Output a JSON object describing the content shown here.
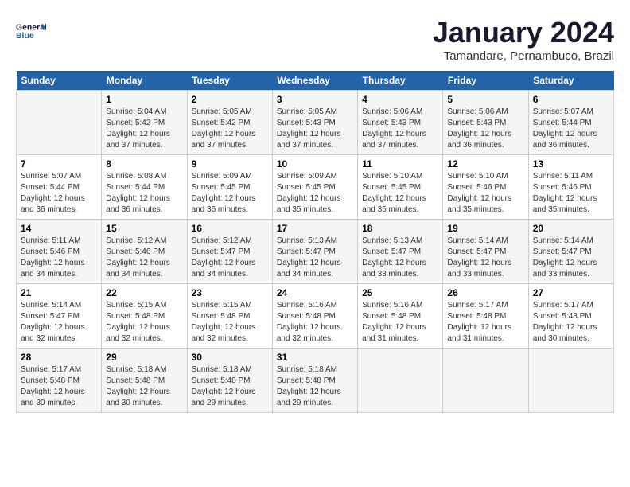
{
  "logo": {
    "line1": "General",
    "line2": "Blue"
  },
  "title": "January 2024",
  "subtitle": "Tamandare, Pernambuco, Brazil",
  "days_header": [
    "Sunday",
    "Monday",
    "Tuesday",
    "Wednesday",
    "Thursday",
    "Friday",
    "Saturday"
  ],
  "weeks": [
    [
      {
        "day": "",
        "sunrise": "",
        "sunset": "",
        "daylight": ""
      },
      {
        "day": "1",
        "sunrise": "Sunrise: 5:04 AM",
        "sunset": "Sunset: 5:42 PM",
        "daylight": "Daylight: 12 hours and 37 minutes."
      },
      {
        "day": "2",
        "sunrise": "Sunrise: 5:05 AM",
        "sunset": "Sunset: 5:42 PM",
        "daylight": "Daylight: 12 hours and 37 minutes."
      },
      {
        "day": "3",
        "sunrise": "Sunrise: 5:05 AM",
        "sunset": "Sunset: 5:43 PM",
        "daylight": "Daylight: 12 hours and 37 minutes."
      },
      {
        "day": "4",
        "sunrise": "Sunrise: 5:06 AM",
        "sunset": "Sunset: 5:43 PM",
        "daylight": "Daylight: 12 hours and 37 minutes."
      },
      {
        "day": "5",
        "sunrise": "Sunrise: 5:06 AM",
        "sunset": "Sunset: 5:43 PM",
        "daylight": "Daylight: 12 hours and 36 minutes."
      },
      {
        "day": "6",
        "sunrise": "Sunrise: 5:07 AM",
        "sunset": "Sunset: 5:44 PM",
        "daylight": "Daylight: 12 hours and 36 minutes."
      }
    ],
    [
      {
        "day": "7",
        "sunrise": "Sunrise: 5:07 AM",
        "sunset": "Sunset: 5:44 PM",
        "daylight": "Daylight: 12 hours and 36 minutes."
      },
      {
        "day": "8",
        "sunrise": "Sunrise: 5:08 AM",
        "sunset": "Sunset: 5:44 PM",
        "daylight": "Daylight: 12 hours and 36 minutes."
      },
      {
        "day": "9",
        "sunrise": "Sunrise: 5:09 AM",
        "sunset": "Sunset: 5:45 PM",
        "daylight": "Daylight: 12 hours and 36 minutes."
      },
      {
        "day": "10",
        "sunrise": "Sunrise: 5:09 AM",
        "sunset": "Sunset: 5:45 PM",
        "daylight": "Daylight: 12 hours and 35 minutes."
      },
      {
        "day": "11",
        "sunrise": "Sunrise: 5:10 AM",
        "sunset": "Sunset: 5:45 PM",
        "daylight": "Daylight: 12 hours and 35 minutes."
      },
      {
        "day": "12",
        "sunrise": "Sunrise: 5:10 AM",
        "sunset": "Sunset: 5:46 PM",
        "daylight": "Daylight: 12 hours and 35 minutes."
      },
      {
        "day": "13",
        "sunrise": "Sunrise: 5:11 AM",
        "sunset": "Sunset: 5:46 PM",
        "daylight": "Daylight: 12 hours and 35 minutes."
      }
    ],
    [
      {
        "day": "14",
        "sunrise": "Sunrise: 5:11 AM",
        "sunset": "Sunset: 5:46 PM",
        "daylight": "Daylight: 12 hours and 34 minutes."
      },
      {
        "day": "15",
        "sunrise": "Sunrise: 5:12 AM",
        "sunset": "Sunset: 5:46 PM",
        "daylight": "Daylight: 12 hours and 34 minutes."
      },
      {
        "day": "16",
        "sunrise": "Sunrise: 5:12 AM",
        "sunset": "Sunset: 5:47 PM",
        "daylight": "Daylight: 12 hours and 34 minutes."
      },
      {
        "day": "17",
        "sunrise": "Sunrise: 5:13 AM",
        "sunset": "Sunset: 5:47 PM",
        "daylight": "Daylight: 12 hours and 34 minutes."
      },
      {
        "day": "18",
        "sunrise": "Sunrise: 5:13 AM",
        "sunset": "Sunset: 5:47 PM",
        "daylight": "Daylight: 12 hours and 33 minutes."
      },
      {
        "day": "19",
        "sunrise": "Sunrise: 5:14 AM",
        "sunset": "Sunset: 5:47 PM",
        "daylight": "Daylight: 12 hours and 33 minutes."
      },
      {
        "day": "20",
        "sunrise": "Sunrise: 5:14 AM",
        "sunset": "Sunset: 5:47 PM",
        "daylight": "Daylight: 12 hours and 33 minutes."
      }
    ],
    [
      {
        "day": "21",
        "sunrise": "Sunrise: 5:14 AM",
        "sunset": "Sunset: 5:47 PM",
        "daylight": "Daylight: 12 hours and 32 minutes."
      },
      {
        "day": "22",
        "sunrise": "Sunrise: 5:15 AM",
        "sunset": "Sunset: 5:48 PM",
        "daylight": "Daylight: 12 hours and 32 minutes."
      },
      {
        "day": "23",
        "sunrise": "Sunrise: 5:15 AM",
        "sunset": "Sunset: 5:48 PM",
        "daylight": "Daylight: 12 hours and 32 minutes."
      },
      {
        "day": "24",
        "sunrise": "Sunrise: 5:16 AM",
        "sunset": "Sunset: 5:48 PM",
        "daylight": "Daylight: 12 hours and 32 minutes."
      },
      {
        "day": "25",
        "sunrise": "Sunrise: 5:16 AM",
        "sunset": "Sunset: 5:48 PM",
        "daylight": "Daylight: 12 hours and 31 minutes."
      },
      {
        "day": "26",
        "sunrise": "Sunrise: 5:17 AM",
        "sunset": "Sunset: 5:48 PM",
        "daylight": "Daylight: 12 hours and 31 minutes."
      },
      {
        "day": "27",
        "sunrise": "Sunrise: 5:17 AM",
        "sunset": "Sunset: 5:48 PM",
        "daylight": "Daylight: 12 hours and 30 minutes."
      }
    ],
    [
      {
        "day": "28",
        "sunrise": "Sunrise: 5:17 AM",
        "sunset": "Sunset: 5:48 PM",
        "daylight": "Daylight: 12 hours and 30 minutes."
      },
      {
        "day": "29",
        "sunrise": "Sunrise: 5:18 AM",
        "sunset": "Sunset: 5:48 PM",
        "daylight": "Daylight: 12 hours and 30 minutes."
      },
      {
        "day": "30",
        "sunrise": "Sunrise: 5:18 AM",
        "sunset": "Sunset: 5:48 PM",
        "daylight": "Daylight: 12 hours and 29 minutes."
      },
      {
        "day": "31",
        "sunrise": "Sunrise: 5:18 AM",
        "sunset": "Sunset: 5:48 PM",
        "daylight": "Daylight: 12 hours and 29 minutes."
      },
      {
        "day": "",
        "sunrise": "",
        "sunset": "",
        "daylight": ""
      },
      {
        "day": "",
        "sunrise": "",
        "sunset": "",
        "daylight": ""
      },
      {
        "day": "",
        "sunrise": "",
        "sunset": "",
        "daylight": ""
      }
    ]
  ]
}
